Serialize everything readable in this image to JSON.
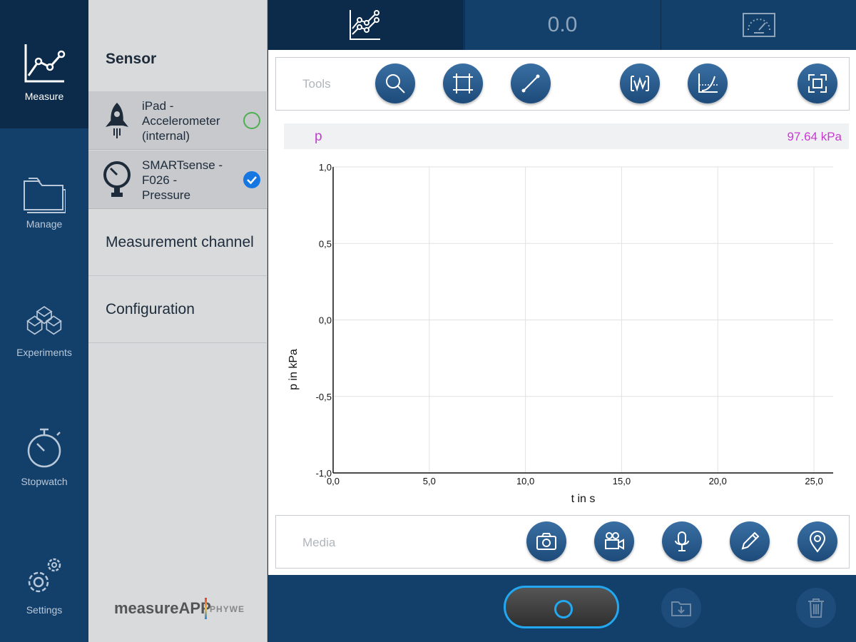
{
  "nav": {
    "measure": "Measure",
    "manage": "Manage",
    "experiments": "Experiments",
    "stopwatch": "Stopwatch",
    "settings": "Settings"
  },
  "side": {
    "title": "Sensor",
    "sensors": [
      {
        "name": "iPad -\nAccelerometer\n(internal)",
        "selected": false
      },
      {
        "name": "SMARTsense -\nF026    -\nPressure",
        "selected": true
      }
    ],
    "links": [
      "Measurement channel",
      "Configuration"
    ],
    "brand": "measureAPP",
    "brand_sub": "PHYWE"
  },
  "tabs": {
    "value_display": "0.0"
  },
  "toolbar": {
    "label": "Tools",
    "buttons": [
      "zoom-icon",
      "crop-icon",
      "line-tool-icon",
      "waveform-icon",
      "curve-fit-icon",
      "fullscreen-icon"
    ]
  },
  "channel": {
    "name": "p",
    "value": "97.64 kPa",
    "color": "#c63ad0"
  },
  "chart_data": {
    "type": "line",
    "xlabel": "t in s",
    "ylabel": "p in kPa",
    "xlim": [
      0,
      26
    ],
    "ylim": [
      -1,
      1
    ],
    "x_ticks": [
      "0,0",
      "5,0",
      "10,0",
      "15,0",
      "20,0",
      "25,0"
    ],
    "x_tick_values": [
      0,
      5,
      10,
      15,
      20,
      25
    ],
    "y_ticks": [
      "1,0",
      "0,5",
      "0,0",
      "-0,5",
      "-1,0"
    ],
    "y_tick_values": [
      1,
      0.5,
      0,
      -0.5,
      -1
    ],
    "grid": true,
    "series": []
  },
  "media": {
    "label": "Media",
    "buttons": [
      "camera-icon",
      "video-icon",
      "microphone-icon",
      "pencil-icon",
      "location-icon"
    ]
  },
  "colors": {
    "nav_bg": "#13406b",
    "nav_active": "#0c2b4a",
    "record_accent": "#22a8f0"
  }
}
